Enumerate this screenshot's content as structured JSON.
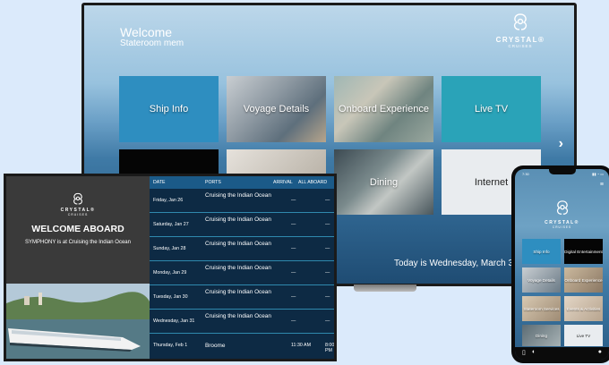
{
  "tv": {
    "welcome": "Welcome",
    "stateroom": "Stateroom mem",
    "logo": {
      "brand": "CRYSTAL®",
      "sub": "CRUISES"
    },
    "tiles": [
      "Ship Info",
      "Voyage Details",
      "Onboard Experience",
      "Live TV",
      "Dining",
      "Internet"
    ],
    "today": "Today is Wednesday, March 31st"
  },
  "signage": {
    "logo": {
      "brand": "CRYSTAL®",
      "sub": "CRUISES"
    },
    "welcome": "WELCOME ABOARD",
    "status": "SYMPHONY is at Cruising the Indian Ocean",
    "headers": {
      "date": "DATE",
      "ports": "PORTS",
      "arrival": "ARRIVAL",
      "all_aboard": "ALL ABOARD"
    },
    "rows": [
      {
        "date": "Friday, Jan 26",
        "port": "Cruising the Indian Ocean",
        "arrival": "—",
        "all_aboard": "—"
      },
      {
        "date": "Saturday, Jan 27",
        "port": "Cruising the Indian Ocean",
        "arrival": "—",
        "all_aboard": "—"
      },
      {
        "date": "Sunday, Jan 28",
        "port": "Cruising the Indian Ocean",
        "arrival": "—",
        "all_aboard": "—"
      },
      {
        "date": "Monday, Jan 29",
        "port": "Cruising the Indian Ocean",
        "arrival": "—",
        "all_aboard": "—"
      },
      {
        "date": "Tuesday, Jan 30",
        "port": "Cruising the Indian Ocean",
        "arrival": "—",
        "all_aboard": "—"
      },
      {
        "date": "Wednesday, Jan 31",
        "port": "Cruising the Indian Ocean",
        "arrival": "—",
        "all_aboard": "—"
      },
      {
        "date": "Thursday, Feb 1",
        "port": "Broome",
        "arrival": "11:30 AM",
        "all_aboard": "8:00 PM"
      }
    ]
  },
  "phone": {
    "time": "7:30",
    "status_icons": "▮▮ ◔ ▭",
    "logo": {
      "brand": "CRYSTAL®",
      "sub": "CRUISES"
    },
    "tiles": [
      "Ship Info",
      "Digital Entertainment",
      "Voyage Details",
      "Onboard Experience",
      "Stateroom Services",
      "Events & Activities",
      "Dining",
      "Live TV"
    ]
  },
  "icons": {
    "crest": "crest-icon",
    "next": "chevron-right-icon",
    "menu": "menu-icon"
  },
  "colors": {
    "tile_blue": "#2e8ec0",
    "tile_teal": "#2aa3b8",
    "tile_white": "#e9ecef",
    "sign_bg": "#0d2a44",
    "sign_header": "#1b5a88",
    "row_rule": "#2f89ae"
  }
}
